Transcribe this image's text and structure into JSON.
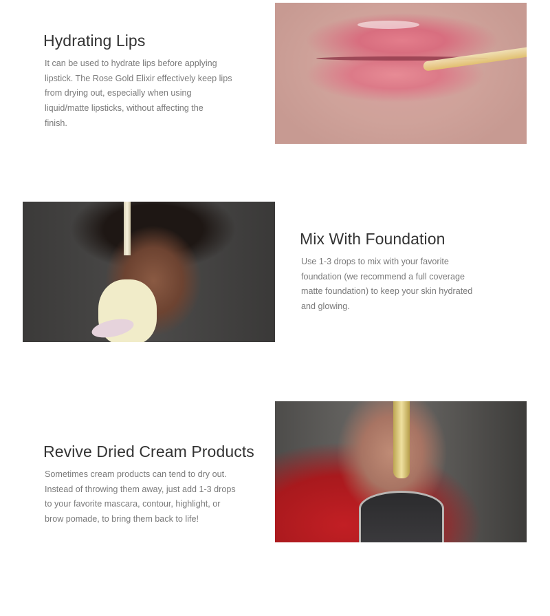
{
  "sections": [
    {
      "title": "Hydrating Lips",
      "lines": [
        "It can be used to hydrate lips before applying",
        "lipstick. The Rose Gold Elixir effectively keep lips",
        "from drying out, especially when using",
        "liquid/matte lipsticks, without affecting the",
        "finish."
      ]
    },
    {
      "title": "Mix With Foundation",
      "lines": [
        "Use 1-3 drops to mix with your favorite",
        "foundation (we recommend a full coverage",
        "matte foundation) to keep your skin hydrated",
        "and glowing."
      ]
    },
    {
      "title": "Revive Dried Cream Products",
      "lines": [
        "Sometimes cream products can tend to dry out.",
        "Instead of throwing them away, just add 1-3 drops",
        "to your favorite mascara, contour, highlight, or",
        "brow pomade, to bring them back to life!"
      ]
    }
  ]
}
